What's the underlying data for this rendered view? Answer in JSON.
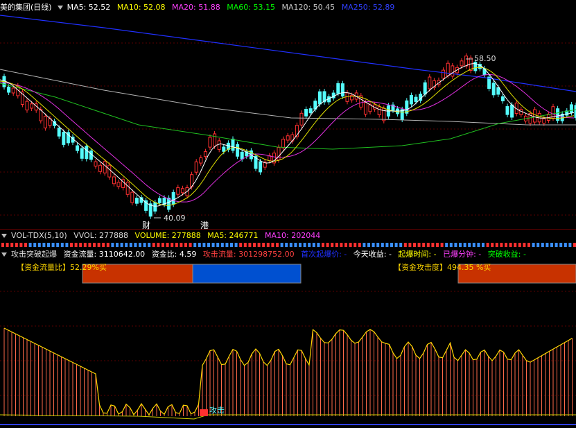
{
  "header": {
    "title": "美的集团(日线)",
    "ma5": "MA5: 52.52",
    "ma10": "MA10: 52.08",
    "ma20": "MA20: 51.88",
    "ma60": "MA60: 53.15",
    "ma120": "MA120: 50.45",
    "ma250": "MA250: 52.89"
  },
  "price_chart": {
    "high_label": "58.50",
    "low_label": "40.09",
    "marker_cai": "财",
    "marker_gang": "港"
  },
  "volume_bar": {
    "title": "VOL-TDX(5,10)",
    "vvol": "VVOL: 277888",
    "volume": "VOLUME: 277888",
    "ma5": "MA5: 246771",
    "ma10": "MA10: 202044"
  },
  "attack_bar": {
    "title": "攻击突破起爆",
    "capital_flow": "资金流量: 3110642.00",
    "capital_ratio": "资金比: 4.59",
    "attack_flow": "攻击流量: 301298752.00",
    "first_explosion_price": "首次起爆价: -",
    "today_profit": "今天收益: -",
    "explosion_time": "起爆时间: -",
    "explosion_minutes": "已爆分钟: -",
    "breakout_profit": "突破收益: -"
  },
  "indicators": {
    "flow_ratio_label": "【资金流量比】52.29%买",
    "attack_degree_label": "【资金攻击度】494.35 %买",
    "attack_signal": "攻击"
  },
  "colors": {
    "ma5": "#ffffff",
    "ma10": "#ffff00",
    "ma20": "#ff00ff",
    "ma60": "#00ff00",
    "ma120": "#c8c8c8",
    "ma250": "#0000ff",
    "up": "#ff3030",
    "down": "#54fcfc"
  }
}
